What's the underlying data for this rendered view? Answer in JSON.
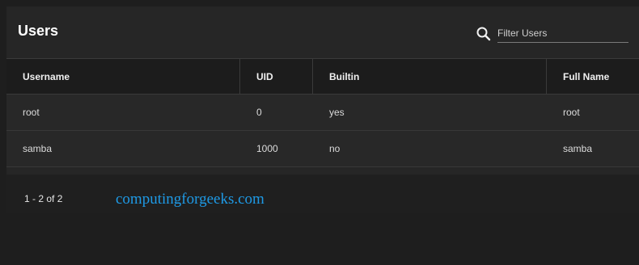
{
  "header": {
    "title": "Users",
    "search_placeholder": "Filter Users",
    "search_icon": "search-icon"
  },
  "table": {
    "columns": [
      "Username",
      "UID",
      "Builtin",
      "Full Name"
    ],
    "rows": [
      {
        "username": "root",
        "uid": "0",
        "builtin": "yes",
        "full_name": "root"
      },
      {
        "username": "samba",
        "uid": "1000",
        "builtin": "no",
        "full_name": "samba"
      }
    ]
  },
  "footer": {
    "pagination": "1 - 2 of 2",
    "watermark": "computingforgeeks.com"
  },
  "colors": {
    "background": "#1e1e1e",
    "panel": "#262626",
    "header_row": "#1c1c1c",
    "watermark": "#1e9ae6"
  }
}
